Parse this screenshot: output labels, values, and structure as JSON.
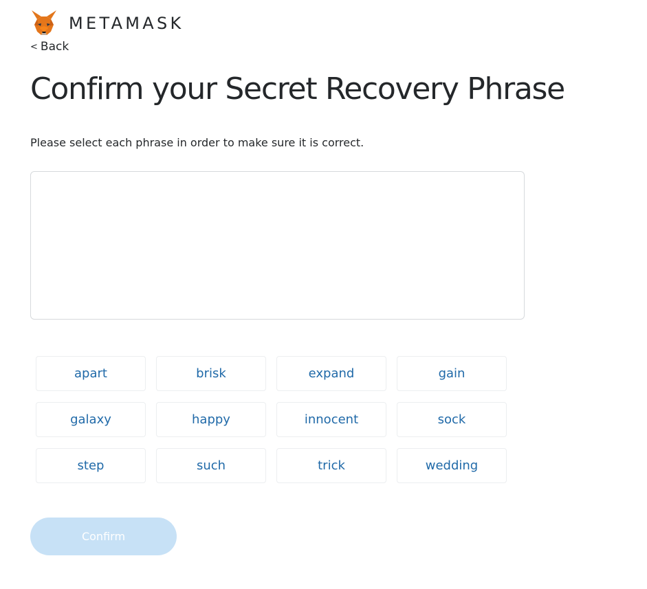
{
  "brand": {
    "logo_icon": "metamask-fox-icon",
    "wordmark": "METAMASK"
  },
  "nav": {
    "back_chevron": "<",
    "back_label": "Back"
  },
  "page": {
    "title": "Confirm your Secret Recovery Phrase",
    "subtitle": "Please select each phrase in order to make sure it is correct."
  },
  "words": [
    "apart",
    "brisk",
    "expand",
    "gain",
    "galaxy",
    "happy",
    "innocent",
    "sock",
    "step",
    "such",
    "trick",
    "wedding"
  ],
  "confirm": {
    "label": "Confirm",
    "disabled": true
  },
  "colors": {
    "word_text": "#1f69a8",
    "confirm_disabled_bg": "#c7e1f6",
    "fox_orange": "#e2761b"
  }
}
